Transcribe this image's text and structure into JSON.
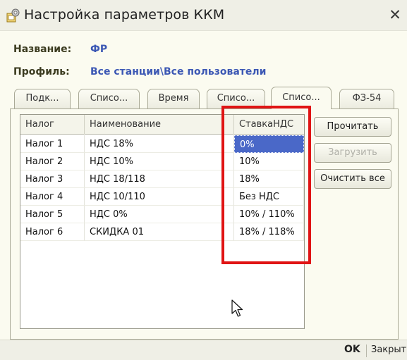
{
  "window": {
    "title": "Настройка параметров ККМ"
  },
  "info": {
    "name_label": "Название:",
    "name_value": "ФР",
    "profile_label": "Профиль:",
    "profile_value": "Все станции\\Все пользователи"
  },
  "tabs": [
    {
      "label": "Подк..."
    },
    {
      "label": "Списо..."
    },
    {
      "label": "Время"
    },
    {
      "label": "Списо..."
    },
    {
      "label": "Списо...",
      "active": true
    },
    {
      "label": "ФЗ-54"
    }
  ],
  "grid": {
    "columns": [
      "Налог",
      "Наименование",
      "СтавкаНДС"
    ],
    "rows": [
      [
        "Налог 1",
        "НДС 18%",
        "0%"
      ],
      [
        "Налог 2",
        "НДС 10%",
        "10%"
      ],
      [
        "Налог 3",
        "НДС 18/118",
        "18%"
      ],
      [
        "Налог 4",
        "НДС 10/110",
        "Без НДС"
      ],
      [
        "Налог 5",
        "НДС 0%",
        "10% / 110%"
      ],
      [
        "Налог 6",
        "СКИДКА 01",
        "18% / 118%"
      ]
    ],
    "selected_row": 0,
    "selected_col": 2
  },
  "side_buttons": {
    "read": "Прочитать",
    "load": "Загрузить",
    "clear_all": "Очистить все"
  },
  "footer": {
    "ok": "OK",
    "close": "Закрыть"
  },
  "colors": {
    "highlight": "#e01414",
    "selection": "#4a68c8",
    "value_text": "#3c58b4"
  }
}
